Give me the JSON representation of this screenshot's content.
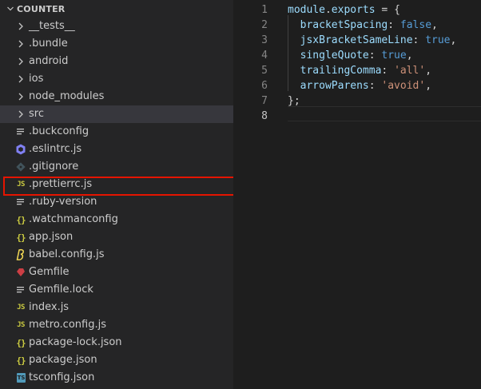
{
  "explorer": {
    "section_title": "COUNTER",
    "items": [
      {
        "label": "__tests__",
        "icon": "chevron-right-icon",
        "kind": "folder"
      },
      {
        "label": ".bundle",
        "icon": "chevron-right-icon",
        "kind": "folder"
      },
      {
        "label": "android",
        "icon": "chevron-right-icon",
        "kind": "folder"
      },
      {
        "label": "ios",
        "icon": "chevron-right-icon",
        "kind": "folder"
      },
      {
        "label": "node_modules",
        "icon": "chevron-right-icon",
        "kind": "folder"
      },
      {
        "label": "src",
        "icon": "chevron-right-icon",
        "kind": "folder",
        "selected": true
      },
      {
        "label": ".buckconfig",
        "icon": "lines-file-icon",
        "kind": "file"
      },
      {
        "label": ".eslintrc.js",
        "icon": "eslint-icon",
        "kind": "file"
      },
      {
        "label": ".gitignore",
        "icon": "git-icon",
        "kind": "file"
      },
      {
        "label": ".prettierrc.js",
        "icon": "js-file-icon",
        "icon_text": "JS",
        "kind": "file",
        "highlighted": true
      },
      {
        "label": ".ruby-version",
        "icon": "lines-file-icon",
        "kind": "file"
      },
      {
        "label": ".watchmanconfig",
        "icon": "json-file-icon",
        "icon_text": "{}",
        "kind": "file"
      },
      {
        "label": "app.json",
        "icon": "json-file-icon",
        "icon_text": "{}",
        "kind": "file"
      },
      {
        "label": "babel.config.js",
        "icon": "babel-icon",
        "kind": "file"
      },
      {
        "label": "Gemfile",
        "icon": "ruby-icon",
        "kind": "file"
      },
      {
        "label": "Gemfile.lock",
        "icon": "lines-file-icon",
        "kind": "file"
      },
      {
        "label": "index.js",
        "icon": "js-file-icon",
        "icon_text": "JS",
        "kind": "file"
      },
      {
        "label": "metro.config.js",
        "icon": "js-file-icon",
        "icon_text": "JS",
        "kind": "file"
      },
      {
        "label": "package-lock.json",
        "icon": "json-file-icon",
        "icon_text": "{}",
        "kind": "file"
      },
      {
        "label": "package.json",
        "icon": "json-file-icon",
        "icon_text": "{}",
        "kind": "file"
      },
      {
        "label": "tsconfig.json",
        "icon": "ts-file-icon",
        "icon_text": "TS",
        "kind": "file"
      }
    ]
  },
  "editor": {
    "active_line": 8,
    "lines": [
      {
        "number": "1",
        "tokens": [
          {
            "t": "var",
            "v": "module"
          },
          {
            "t": "punc",
            "v": "."
          },
          {
            "t": "var",
            "v": "exports"
          },
          {
            "t": "punc",
            "v": " = {"
          }
        ]
      },
      {
        "number": "2",
        "tokens": [
          {
            "t": "punc",
            "v": "  "
          },
          {
            "t": "var",
            "v": "bracketSpacing"
          },
          {
            "t": "punc",
            "v": ": "
          },
          {
            "t": "const",
            "v": "false"
          },
          {
            "t": "punc",
            "v": ","
          }
        ]
      },
      {
        "number": "3",
        "tokens": [
          {
            "t": "punc",
            "v": "  "
          },
          {
            "t": "var",
            "v": "jsxBracketSameLine"
          },
          {
            "t": "punc",
            "v": ": "
          },
          {
            "t": "const",
            "v": "true"
          },
          {
            "t": "punc",
            "v": ","
          }
        ]
      },
      {
        "number": "4",
        "tokens": [
          {
            "t": "punc",
            "v": "  "
          },
          {
            "t": "var",
            "v": "singleQuote"
          },
          {
            "t": "punc",
            "v": ": "
          },
          {
            "t": "const",
            "v": "true"
          },
          {
            "t": "punc",
            "v": ","
          }
        ]
      },
      {
        "number": "5",
        "tokens": [
          {
            "t": "punc",
            "v": "  "
          },
          {
            "t": "var",
            "v": "trailingComma"
          },
          {
            "t": "punc",
            "v": ": "
          },
          {
            "t": "str",
            "v": "'all'"
          },
          {
            "t": "punc",
            "v": ","
          }
        ]
      },
      {
        "number": "6",
        "tokens": [
          {
            "t": "punc",
            "v": "  "
          },
          {
            "t": "var",
            "v": "arrowParens"
          },
          {
            "t": "punc",
            "v": ": "
          },
          {
            "t": "str",
            "v": "'avoid'"
          },
          {
            "t": "punc",
            "v": ","
          }
        ]
      },
      {
        "number": "7",
        "tokens": [
          {
            "t": "punc",
            "v": "};"
          }
        ]
      },
      {
        "number": "8",
        "tokens": []
      }
    ]
  },
  "colors": {
    "sidebar_bg": "#252526",
    "editor_bg": "#1e1e1e",
    "selected_row": "#37373d",
    "highlight_box": "#e51400",
    "js_yellow": "#cbcb41",
    "keyword_blue": "#569cd6",
    "string_orange": "#ce9178",
    "property_blue": "#9cdcfe"
  }
}
